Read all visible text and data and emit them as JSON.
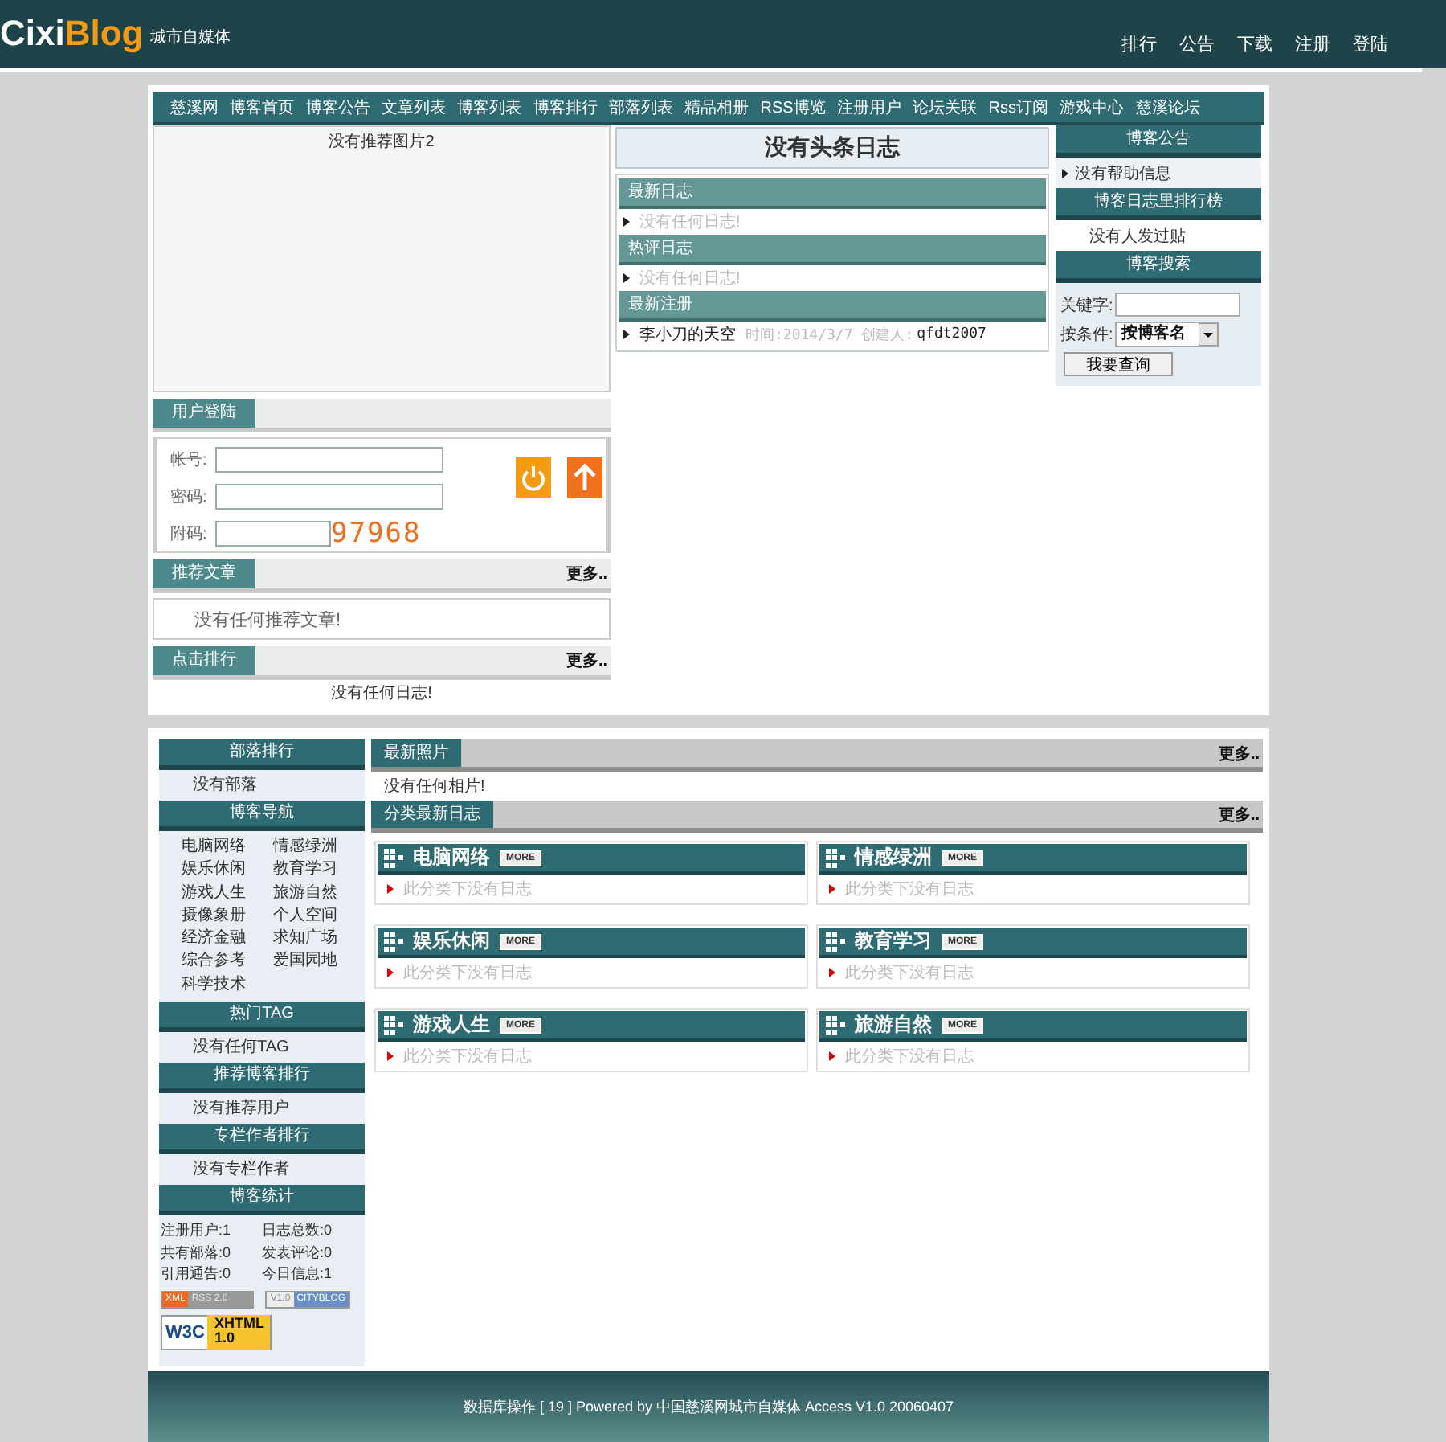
{
  "header": {
    "logo_a": "Cixi",
    "logo_b": "Blog",
    "tagline": "城市自媒体",
    "links": [
      "排行",
      "公告",
      "下载",
      "注册",
      "登陆"
    ]
  },
  "nav": [
    "慈溪网",
    "博客首页",
    "博客公告",
    "文章列表",
    "博客列表",
    "博客排行",
    "部落列表",
    "精品相册",
    "RSS博览",
    "注册用户",
    "论坛关联",
    "Rss订阅",
    "游戏中心",
    "慈溪论坛"
  ],
  "featured_picture": {
    "caption": "没有推荐图片2"
  },
  "login": {
    "title": "用户登陆",
    "fields": [
      {
        "label": "帐号:"
      },
      {
        "label": "密码:"
      },
      {
        "label": "附码:"
      }
    ],
    "captcha": "97968"
  },
  "recommended": {
    "title": "推荐文章",
    "more": "更多..",
    "empty": "没有任何推荐文章!"
  },
  "clicks": {
    "title": "点击排行",
    "more": "更多..",
    "empty": "没有任何日志!"
  },
  "headline": "没有头条日志",
  "center_sections": [
    {
      "title": "最新日志",
      "items": [
        {
          "kind": "empty",
          "text": "没有任何日志!"
        }
      ]
    },
    {
      "title": "热评日志",
      "items": [
        {
          "kind": "empty",
          "text": "没有任何日志!"
        }
      ]
    },
    {
      "title": "最新注册",
      "items": [
        {
          "kind": "entry",
          "text": "李小刀的天空",
          "meta": "时间:2014/3/7 创建人:",
          "author": "qfdt2007"
        }
      ]
    }
  ],
  "notice": {
    "title": "博客公告",
    "item": "没有帮助信息"
  },
  "ranking": {
    "title": "博客日志里排行榜",
    "empty": "没有人发过贴"
  },
  "search": {
    "title": "博客搜索",
    "keyword_label": "关键字:",
    "condition_label": "按条件:",
    "condition_value": "按博客名",
    "button": "我要查询"
  },
  "sidebar": [
    {
      "kind": "text",
      "title": "部落排行",
      "text": "没有部落"
    },
    {
      "kind": "grid",
      "title": "博客导航",
      "items": [
        "电脑网络",
        "情感绿洲",
        "娱乐休闲",
        "教育学习",
        "游戏人生",
        "旅游自然",
        "摄像象册",
        "个人空间",
        "经济金融",
        "求知广场",
        "综合参考",
        "爱国园地",
        "科学技术"
      ]
    },
    {
      "kind": "text",
      "title": "热门TAG",
      "text": "没有任何TAG"
    },
    {
      "kind": "text",
      "title": "推荐博客排行",
      "text": "没有推荐用户"
    },
    {
      "kind": "text",
      "title": "专栏作者排行",
      "text": "没有专栏作者"
    },
    {
      "kind": "stats",
      "title": "博客统计",
      "items": [
        "注册用户:1",
        "日志总数:0",
        "共有部落:0",
        "发表评论:0",
        "引用通告:0",
        "今日信息:1"
      ],
      "badges": [
        {
          "kind": "xml",
          "left": "XML",
          "right": "RSS 2.0"
        },
        {
          "kind": "ver",
          "left": "V1.0",
          "right": "CITYBLOG"
        },
        {
          "kind": "w3c",
          "left": "W3C",
          "right": "XHTML",
          "sub": "1.0"
        }
      ]
    }
  ],
  "photos": {
    "title": "最新照片",
    "more": "更多..",
    "empty": "没有任何相片!"
  },
  "categories": {
    "title": "分类最新日志",
    "more": "更多..",
    "items": [
      {
        "name": "电脑网络",
        "tag": "MORE",
        "empty": "此分类下没有日志"
      },
      {
        "name": "情感绿洲",
        "tag": "MORE",
        "empty": "此分类下没有日志"
      },
      {
        "name": "娱乐休闲",
        "tag": "MORE",
        "empty": "此分类下没有日志"
      },
      {
        "name": "教育学习",
        "tag": "MORE",
        "empty": "此分类下没有日志"
      },
      {
        "name": "游戏人生",
        "tag": "MORE",
        "empty": "此分类下没有日志"
      },
      {
        "name": "旅游自然",
        "tag": "MORE",
        "empty": "此分类下没有日志"
      }
    ]
  },
  "footer": "数据库操作 [ 19 ] Powered by 中国慈溪网城市自媒体 Access V1.0 20060407"
}
